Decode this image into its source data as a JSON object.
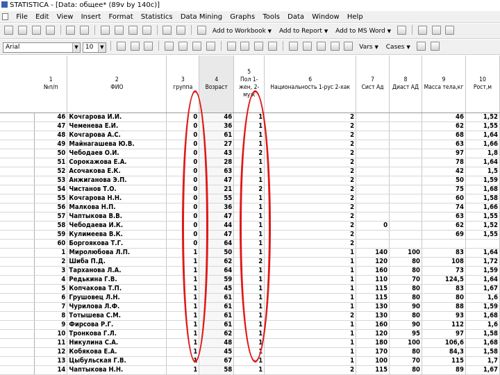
{
  "window": {
    "title": "STATISTICA - [Data: общее* (89v by 140c)]"
  },
  "menubar": {
    "items": [
      "File",
      "Edit",
      "View",
      "Insert",
      "Format",
      "Statistics",
      "Data Mining",
      "Graphs",
      "Tools",
      "Data",
      "Window",
      "Help"
    ]
  },
  "toolbar": {
    "add_to_workbook": "Add to Workbook",
    "add_to_report": "Add to Report",
    "add_to_msword": "Add to MS Word",
    "font_name": "Arial",
    "font_size": "10",
    "vars": "Vars",
    "cases": "Cases"
  },
  "columns": [
    {
      "num": "1",
      "label": "№п/п"
    },
    {
      "num": "2",
      "label": "ФИО"
    },
    {
      "num": "3",
      "label": "группа"
    },
    {
      "num": "4",
      "label": "Возраст"
    },
    {
      "num": "5",
      "label": "Пол 1-жен, 2-муж"
    },
    {
      "num": "6",
      "label": "Национальность 1-рус 2-хак"
    },
    {
      "num": "7",
      "label": "Сист Ад"
    },
    {
      "num": "8",
      "label": "Диаст АД"
    },
    {
      "num": "9",
      "label": "Масса тела,кг"
    },
    {
      "num": "10",
      "label": "Рост,м"
    }
  ],
  "rows": [
    [
      "46",
      "Кочгарова И.И.",
      "0",
      "46",
      "1",
      "2",
      "",
      "",
      "46",
      "1,52"
    ],
    [
      "47",
      "Чеменева Е.И.",
      "0",
      "36",
      "1",
      "2",
      "",
      "",
      "62",
      "1,55"
    ],
    [
      "48",
      "Кочгарова А.С.",
      "0",
      "61",
      "1",
      "2",
      "",
      "",
      "68",
      "1,64"
    ],
    [
      "49",
      "Майнагашева Ю.В.",
      "0",
      "27",
      "1",
      "2",
      "",
      "",
      "63",
      "1,66"
    ],
    [
      "50",
      "Чебодаев О.И.",
      "0",
      "43",
      "2",
      "2",
      "",
      "",
      "97",
      "1,8"
    ],
    [
      "51",
      "Сорокажова Е.А.",
      "0",
      "28",
      "1",
      "2",
      "",
      "",
      "78",
      "1,64"
    ],
    [
      "52",
      "Асочакова Е.К.",
      "0",
      "63",
      "1",
      "2",
      "",
      "",
      "42",
      "1,5"
    ],
    [
      "53",
      "Анжиганова Э.П.",
      "0",
      "47",
      "1",
      "2",
      "",
      "",
      "50",
      "1,59"
    ],
    [
      "54",
      "Чистанов Т.О.",
      "0",
      "21",
      "2",
      "2",
      "",
      "",
      "75",
      "1,68"
    ],
    [
      "55",
      "Кочгарова Н.Н.",
      "0",
      "55",
      "1",
      "2",
      "",
      "",
      "60",
      "1,58"
    ],
    [
      "56",
      "Малкова Н.П.",
      "0",
      "36",
      "1",
      "2",
      "",
      "",
      "74",
      "1,66"
    ],
    [
      "57",
      "Чаптыкова В.В.",
      "0",
      "47",
      "1",
      "2",
      "",
      "",
      "63",
      "1,55"
    ],
    [
      "58",
      "Чебодаева И.К.",
      "0",
      "44",
      "1",
      "2",
      "0",
      "",
      "62",
      "1,52"
    ],
    [
      "59",
      "Кулимеева В.К.",
      "0",
      "47",
      "1",
      "2",
      "",
      "",
      "69",
      "1,55"
    ],
    [
      "60",
      "Боргоякова Т.Г.",
      "0",
      "64",
      "1",
      "2",
      "",
      "",
      "",
      ""
    ],
    [
      "1",
      "Миролюбова Л.П.",
      "1",
      "50",
      "1",
      "1",
      "140",
      "100",
      "83",
      "1,64"
    ],
    [
      "2",
      "Шиба П.Д.",
      "1",
      "62",
      "2",
      "1",
      "120",
      "80",
      "108",
      "1,72"
    ],
    [
      "3",
      "Тарханова Л.А.",
      "1",
      "64",
      "1",
      "1",
      "160",
      "80",
      "73",
      "1,59"
    ],
    [
      "4",
      "Редькина Г.В.",
      "1",
      "59",
      "1",
      "1",
      "110",
      "70",
      "124,5",
      "1,64"
    ],
    [
      "5",
      "Копчакова Т.П.",
      "1",
      "45",
      "1",
      "1",
      "115",
      "80",
      "83",
      "1,67"
    ],
    [
      "6",
      "Грушовец Л.Н.",
      "1",
      "61",
      "1",
      "1",
      "115",
      "80",
      "80",
      "1,6"
    ],
    [
      "7",
      "Чурилова Л.Ф.",
      "1",
      "61",
      "1",
      "1",
      "130",
      "90",
      "88",
      "1,59"
    ],
    [
      "8",
      "Тотышева С.М.",
      "1",
      "61",
      "1",
      "2",
      "130",
      "80",
      "93",
      "1,68"
    ],
    [
      "9",
      "Фирсова Р.Г.",
      "1",
      "61",
      "1",
      "1",
      "160",
      "90",
      "112",
      "1,6"
    ],
    [
      "10",
      "Тронкова Г.Л.",
      "1",
      "62",
      "1",
      "1",
      "120",
      "95",
      "97",
      "1,58"
    ],
    [
      "11",
      "Никулина С.А.",
      "1",
      "48",
      "1",
      "1",
      "180",
      "100",
      "106,6",
      "1,68"
    ],
    [
      "12",
      "Кобякова Е.А.",
      "1",
      "45",
      "1",
      "1",
      "170",
      "80",
      "84,3",
      "1,58"
    ],
    [
      "13",
      "Цыбульская Г.В.",
      "1",
      "67",
      "1",
      "1",
      "100",
      "70",
      "115",
      "1,7"
    ],
    [
      "14",
      "Чаптыкова Н.Н.",
      "1",
      "58",
      "1",
      "2",
      "115",
      "80",
      "89",
      "1,67"
    ]
  ]
}
